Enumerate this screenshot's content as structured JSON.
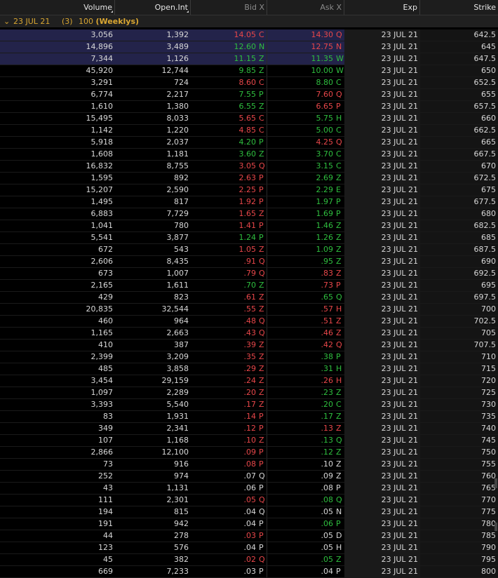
{
  "header": {
    "volume": "Volume",
    "open_int": "Open.Int",
    "bid": "Bid X",
    "ask": "Ask X",
    "exp": "Exp",
    "strike": "Strike"
  },
  "group": {
    "chevron": "⌄",
    "date": "23 JUL 21",
    "count": "(3)",
    "multiplier": "100",
    "weeklys": "(Weeklys)"
  },
  "colors": {
    "up": "#2fbf3f",
    "down": "#e8474a",
    "group": "#d9a632",
    "highlight": "#23234a"
  },
  "rows": [
    {
      "vol": "3,056",
      "oi": "1,392",
      "bid": "14.05",
      "bx": "C",
      "ask": "14.30",
      "ax": "Q",
      "exp": "23 JUL 21",
      "strike": "642.5",
      "bc": "dn",
      "ac": "dn",
      "hl": true
    },
    {
      "vol": "14,896",
      "oi": "3,489",
      "bid": "12.60",
      "bx": "N",
      "ask": "12.75",
      "ax": "N",
      "exp": "23 JUL 21",
      "strike": "645",
      "bc": "up",
      "ac": "dn",
      "hl": true
    },
    {
      "vol": "7,344",
      "oi": "1,126",
      "bid": "11.15",
      "bx": "Z",
      "ask": "11.35",
      "ax": "W",
      "exp": "23 JUL 21",
      "strike": "647.5",
      "bc": "up",
      "ac": "up",
      "hl": true
    },
    {
      "vol": "45,920",
      "oi": "12,744",
      "bid": "9.85",
      "bx": "Z",
      "ask": "10.00",
      "ax": "W",
      "exp": "23 JUL 21",
      "strike": "650",
      "bc": "up",
      "ac": "up"
    },
    {
      "vol": "3,291",
      "oi": "724",
      "bid": "8.60",
      "bx": "C",
      "ask": "8.80",
      "ax": "C",
      "exp": "23 JUL 21",
      "strike": "652.5",
      "bc": "dn",
      "ac": "up"
    },
    {
      "vol": "6,774",
      "oi": "2,217",
      "bid": "7.55",
      "bx": "P",
      "ask": "7.60",
      "ax": "Q",
      "exp": "23 JUL 21",
      "strike": "655",
      "bc": "up",
      "ac": "dn"
    },
    {
      "vol": "1,610",
      "oi": "1,380",
      "bid": "6.55",
      "bx": "Z",
      "ask": "6.65",
      "ax": "P",
      "exp": "23 JUL 21",
      "strike": "657.5",
      "bc": "up",
      "ac": "dn"
    },
    {
      "vol": "15,495",
      "oi": "8,033",
      "bid": "5.65",
      "bx": "C",
      "ask": "5.75",
      "ax": "H",
      "exp": "23 JUL 21",
      "strike": "660",
      "bc": "dn",
      "ac": "up"
    },
    {
      "vol": "1,142",
      "oi": "1,220",
      "bid": "4.85",
      "bx": "C",
      "ask": "5.00",
      "ax": "C",
      "exp": "23 JUL 21",
      "strike": "662.5",
      "bc": "dn",
      "ac": "up"
    },
    {
      "vol": "5,918",
      "oi": "2,037",
      "bid": "4.20",
      "bx": "P",
      "ask": "4.25",
      "ax": "Q",
      "exp": "23 JUL 21",
      "strike": "665",
      "bc": "up",
      "ac": "dn"
    },
    {
      "vol": "1,608",
      "oi": "1,181",
      "bid": "3.60",
      "bx": "Z",
      "ask": "3.70",
      "ax": "C",
      "exp": "23 JUL 21",
      "strike": "667.5",
      "bc": "up",
      "ac": "up"
    },
    {
      "vol": "16,832",
      "oi": "8,755",
      "bid": "3.05",
      "bx": "Q",
      "ask": "3.15",
      "ax": "C",
      "exp": "23 JUL 21",
      "strike": "670",
      "bc": "dn",
      "ac": "up"
    },
    {
      "vol": "1,595",
      "oi": "892",
      "bid": "2.63",
      "bx": "P",
      "ask": "2.69",
      "ax": "Z",
      "exp": "23 JUL 21",
      "strike": "672.5",
      "bc": "dn",
      "ac": "up"
    },
    {
      "vol": "15,207",
      "oi": "2,590",
      "bid": "2.25",
      "bx": "P",
      "ask": "2.29",
      "ax": "E",
      "exp": "23 JUL 21",
      "strike": "675",
      "bc": "dn",
      "ac": "up"
    },
    {
      "vol": "1,495",
      "oi": "817",
      "bid": "1.92",
      "bx": "P",
      "ask": "1.97",
      "ax": "P",
      "exp": "23 JUL 21",
      "strike": "677.5",
      "bc": "dn",
      "ac": "up"
    },
    {
      "vol": "6,883",
      "oi": "7,729",
      "bid": "1.65",
      "bx": "Z",
      "ask": "1.69",
      "ax": "P",
      "exp": "23 JUL 21",
      "strike": "680",
      "bc": "dn",
      "ac": "up"
    },
    {
      "vol": "1,041",
      "oi": "780",
      "bid": "1.41",
      "bx": "P",
      "ask": "1.46",
      "ax": "Z",
      "exp": "23 JUL 21",
      "strike": "682.5",
      "bc": "dn",
      "ac": "up"
    },
    {
      "vol": "5,541",
      "oi": "3,877",
      "bid": "1.24",
      "bx": "P",
      "ask": "1.26",
      "ax": "Z",
      "exp": "23 JUL 21",
      "strike": "685",
      "bc": "up",
      "ac": "up"
    },
    {
      "vol": "672",
      "oi": "543",
      "bid": "1.05",
      "bx": "Z",
      "ask": "1.09",
      "ax": "Z",
      "exp": "23 JUL 21",
      "strike": "687.5",
      "bc": "dn",
      "ac": "up"
    },
    {
      "vol": "2,606",
      "oi": "8,435",
      "bid": ".91",
      "bx": "Q",
      "ask": ".95",
      "ax": "Z",
      "exp": "23 JUL 21",
      "strike": "690",
      "bc": "dn",
      "ac": "up"
    },
    {
      "vol": "673",
      "oi": "1,007",
      "bid": ".79",
      "bx": "Q",
      "ask": ".83",
      "ax": "Z",
      "exp": "23 JUL 21",
      "strike": "692.5",
      "bc": "dn",
      "ac": "dn"
    },
    {
      "vol": "2,165",
      "oi": "1,611",
      "bid": ".70",
      "bx": "Z",
      "ask": ".73",
      "ax": "P",
      "exp": "23 JUL 21",
      "strike": "695",
      "bc": "up",
      "ac": "dn"
    },
    {
      "vol": "429",
      "oi": "823",
      "bid": ".61",
      "bx": "Z",
      "ask": ".65",
      "ax": "Q",
      "exp": "23 JUL 21",
      "strike": "697.5",
      "bc": "dn",
      "ac": "up"
    },
    {
      "vol": "20,835",
      "oi": "32,544",
      "bid": ".55",
      "bx": "Z",
      "ask": ".57",
      "ax": "H",
      "exp": "23 JUL 21",
      "strike": "700",
      "bc": "dn",
      "ac": "dn"
    },
    {
      "vol": "460",
      "oi": "964",
      "bid": ".48",
      "bx": "Q",
      "ask": ".51",
      "ax": "Z",
      "exp": "23 JUL 21",
      "strike": "702.5",
      "bc": "dn",
      "ac": "dn"
    },
    {
      "vol": "1,165",
      "oi": "2,663",
      "bid": ".43",
      "bx": "Q",
      "ask": ".46",
      "ax": "Z",
      "exp": "23 JUL 21",
      "strike": "705",
      "bc": "dn",
      "ac": "dn"
    },
    {
      "vol": "410",
      "oi": "387",
      "bid": ".39",
      "bx": "Z",
      "ask": ".42",
      "ax": "Q",
      "exp": "23 JUL 21",
      "strike": "707.5",
      "bc": "dn",
      "ac": "dn"
    },
    {
      "vol": "2,399",
      "oi": "3,209",
      "bid": ".35",
      "bx": "Z",
      "ask": ".38",
      "ax": "P",
      "exp": "23 JUL 21",
      "strike": "710",
      "bc": "dn",
      "ac": "up"
    },
    {
      "vol": "485",
      "oi": "3,858",
      "bid": ".29",
      "bx": "Z",
      "ask": ".31",
      "ax": "H",
      "exp": "23 JUL 21",
      "strike": "715",
      "bc": "dn",
      "ac": "up"
    },
    {
      "vol": "3,454",
      "oi": "29,159",
      "bid": ".24",
      "bx": "Z",
      "ask": ".26",
      "ax": "H",
      "exp": "23 JUL 21",
      "strike": "720",
      "bc": "dn",
      "ac": "dn"
    },
    {
      "vol": "1,097",
      "oi": "2,289",
      "bid": ".20",
      "bx": "Z",
      "ask": ".23",
      "ax": "Z",
      "exp": "23 JUL 21",
      "strike": "725",
      "bc": "dn",
      "ac": "up"
    },
    {
      "vol": "3,393",
      "oi": "5,540",
      "bid": ".17",
      "bx": "Z",
      "ask": ".20",
      "ax": "C",
      "exp": "23 JUL 21",
      "strike": "730",
      "bc": "dn",
      "ac": "up"
    },
    {
      "vol": "83",
      "oi": "1,931",
      "bid": ".14",
      "bx": "P",
      "ask": ".17",
      "ax": "Z",
      "exp": "23 JUL 21",
      "strike": "735",
      "bc": "dn",
      "ac": "up"
    },
    {
      "vol": "349",
      "oi": "2,341",
      "bid": ".12",
      "bx": "P",
      "ask": ".13",
      "ax": "Z",
      "exp": "23 JUL 21",
      "strike": "740",
      "bc": "dn",
      "ac": "dn"
    },
    {
      "vol": "107",
      "oi": "1,168",
      "bid": ".10",
      "bx": "Z",
      "ask": ".13",
      "ax": "Q",
      "exp": "23 JUL 21",
      "strike": "745",
      "bc": "dn",
      "ac": "up"
    },
    {
      "vol": "2,866",
      "oi": "12,100",
      "bid": ".09",
      "bx": "P",
      "ask": ".12",
      "ax": "Z",
      "exp": "23 JUL 21",
      "strike": "750",
      "bc": "dn",
      "ac": "up"
    },
    {
      "vol": "73",
      "oi": "916",
      "bid": ".08",
      "bx": "P",
      "ask": ".10",
      "ax": "Z",
      "exp": "23 JUL 21",
      "strike": "755",
      "bc": "dn",
      "ac": "nt"
    },
    {
      "vol": "252",
      "oi": "974",
      "bid": ".07",
      "bx": "Q",
      "ask": ".09",
      "ax": "Z",
      "exp": "23 JUL 21",
      "strike": "760",
      "bc": "nt",
      "ac": "nt"
    },
    {
      "vol": "43",
      "oi": "1,131",
      "bid": ".06",
      "bx": "P",
      "ask": ".08",
      "ax": "P",
      "exp": "23 JUL 21",
      "strike": "765",
      "bc": "nt",
      "ac": "nt"
    },
    {
      "vol": "111",
      "oi": "2,301",
      "bid": ".05",
      "bx": "Q",
      "ask": ".08",
      "ax": "Q",
      "exp": "23 JUL 21",
      "strike": "770",
      "bc": "dn",
      "ac": "up"
    },
    {
      "vol": "194",
      "oi": "815",
      "bid": ".04",
      "bx": "Q",
      "ask": ".05",
      "ax": "N",
      "exp": "23 JUL 21",
      "strike": "775",
      "bc": "nt",
      "ac": "nt"
    },
    {
      "vol": "191",
      "oi": "942",
      "bid": ".04",
      "bx": "P",
      "ask": ".06",
      "ax": "P",
      "exp": "23 JUL 21",
      "strike": "780",
      "bc": "nt",
      "ac": "up"
    },
    {
      "vol": "44",
      "oi": "278",
      "bid": ".03",
      "bx": "P",
      "ask": ".05",
      "ax": "D",
      "exp": "23 JUL 21",
      "strike": "785",
      "bc": "dn",
      "ac": "nt"
    },
    {
      "vol": "123",
      "oi": "576",
      "bid": ".04",
      "bx": "P",
      "ask": ".05",
      "ax": "H",
      "exp": "23 JUL 21",
      "strike": "790",
      "bc": "nt",
      "ac": "nt"
    },
    {
      "vol": "45",
      "oi": "382",
      "bid": ".02",
      "bx": "Q",
      "ask": ".05",
      "ax": "Z",
      "exp": "23 JUL 21",
      "strike": "795",
      "bc": "dn",
      "ac": "up"
    },
    {
      "vol": "669",
      "oi": "7,233",
      "bid": ".03",
      "bx": "P",
      "ask": ".04",
      "ax": "P",
      "exp": "23 JUL 21",
      "strike": "800",
      "bc": "nt",
      "ac": "nt"
    }
  ]
}
